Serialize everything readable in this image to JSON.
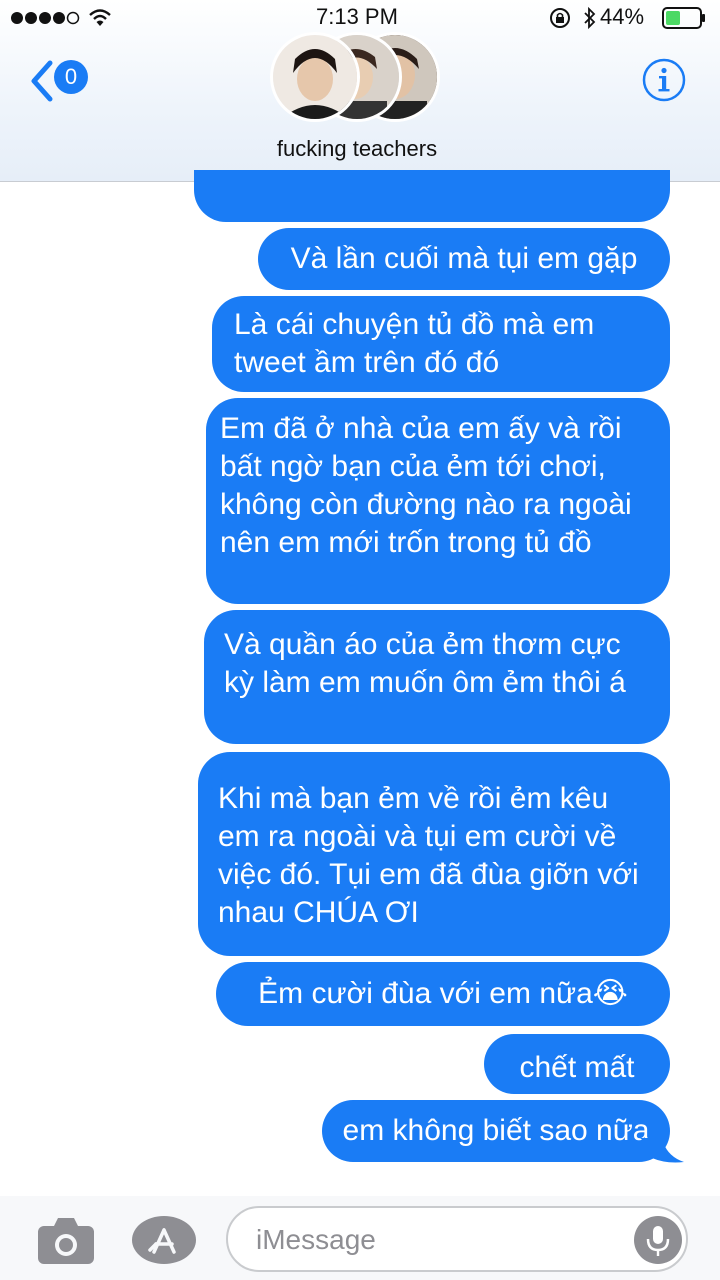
{
  "status_bar": {
    "time": "7:13 PM",
    "battery": "44%"
  },
  "header": {
    "back_count": "0",
    "title": "fucking teachers"
  },
  "messages": [
    "Và lần cuối mà tụi em gặp",
    "Là cái chuyện tủ đồ mà em tweet ầm trên đó đó",
    "Em đã ở nhà của em ấy và rồi bất ngờ bạn của ẻm tới chơi, không còn đường nào ra ngoài nên em mới trốn trong tủ đồ",
    "Và quần áo của ẻm thơm cực kỳ làm em muốn ôm ẻm thôi á",
    "Khi mà bạn ẻm về rồi ẻm kêu em ra ngoài và tụi em cười về việc đó. Tụi em đã đùa giỡn với nhau CHÚA ƠI",
    "Ẻm cười đùa với em nữa😭",
    "chết mất",
    "em không biết sao nữa"
  ],
  "composer": {
    "placeholder": "iMessage"
  },
  "icons": {
    "signal": "signal-dots-icon",
    "wifi": "wifi-icon",
    "lock": "rotation-lock-icon",
    "bluetooth": "bluetooth-icon",
    "battery": "battery-icon",
    "back": "chevron-left-icon",
    "info": "info-icon",
    "camera": "camera-icon",
    "app_store": "app-store-icon",
    "mic": "microphone-icon"
  },
  "colors": {
    "accent": "#1a7cf5",
    "battery_fill": "#4cd964"
  }
}
